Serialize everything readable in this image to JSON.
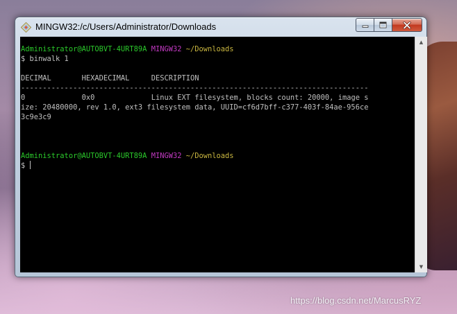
{
  "window": {
    "title": "MINGW32:/c/Users/Administrator/Downloads",
    "controls": {
      "minimize_icon": "minimize-icon",
      "maximize_icon": "maximize-icon",
      "close_icon": "close-icon"
    }
  },
  "terminal": {
    "prompt1": {
      "user_host": "Administrator@AUTOBVT-4URT89A",
      "env": "MINGW32",
      "path": "~/Downloads"
    },
    "command1": "$ binwalk 1",
    "table": {
      "headers": [
        "DECIMAL",
        "HEXADECIMAL",
        "DESCRIPTION"
      ],
      "separator": "--------------------------------------------------------------------------------",
      "rows": [
        {
          "decimal": "0",
          "hexadecimal": "0x0",
          "description_line1": "Linux EXT filesystem, blocks count: 20000, image s",
          "wrap_line2": "ize: 20480000, rev 1.0, ext3 filesystem data, UUID=cf6d7bff-c377-403f-84ae-956ce",
          "wrap_line3": "3c9e3c9"
        }
      ]
    },
    "prompt2": {
      "user_host": "Administrator@AUTOBVT-4URT89A",
      "env": "MINGW32",
      "path": "~/Downloads"
    },
    "prompt_symbol": "$ "
  },
  "watermark": "https://blog.csdn.net/MarcusRYZ",
  "colors": {
    "terminal_bg": "#000000",
    "terminal_text": "#c0c0c0",
    "user_host": "#2bc92b",
    "env": "#c33ac3",
    "path": "#c9b640"
  }
}
